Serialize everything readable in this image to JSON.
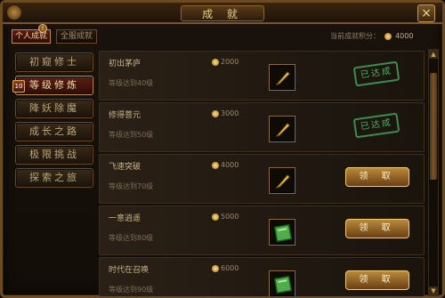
{
  "window": {
    "title": "成 就",
    "close_label": "×"
  },
  "tabs": [
    {
      "label": "个人成就",
      "active": true,
      "badge": "!"
    },
    {
      "label": "全服成就",
      "active": false
    }
  ],
  "score": {
    "label": "当前成就积分：",
    "value": "4000"
  },
  "sidebar": {
    "items": [
      {
        "label": "初窥修士",
        "active": false
      },
      {
        "label": "等级修炼",
        "active": true,
        "badge": "10"
      },
      {
        "label": "降妖除魔",
        "active": false
      },
      {
        "label": "成长之路",
        "active": false
      },
      {
        "label": "极限挑战",
        "active": false
      },
      {
        "label": "探索之旅",
        "active": false
      }
    ]
  },
  "achievements": [
    {
      "name": "初出茅庐",
      "reward": "2000",
      "requirement": "等级达到40级",
      "item": "feather-icon",
      "status": "已达成"
    },
    {
      "name": "修得菩元",
      "reward": "3000",
      "requirement": "等级达到50级",
      "item": "feather-icon",
      "status": "已达成"
    },
    {
      "name": "飞速突破",
      "reward": "4000",
      "requirement": "等级达到70级",
      "item": "feather-icon",
      "status": "领 取"
    },
    {
      "name": "一意逍遥",
      "reward": "5000",
      "requirement": "等级达到80级",
      "item": "book-icon",
      "status": "领 取"
    },
    {
      "name": "时代在召唤",
      "reward": "6000",
      "requirement": "等级达到90级",
      "item": "book-icon",
      "status": "领 取"
    }
  ],
  "colors": {
    "accent_gold": "#c08c4a",
    "done_green": "#3fa25a",
    "active_red": "#5b1f12"
  }
}
